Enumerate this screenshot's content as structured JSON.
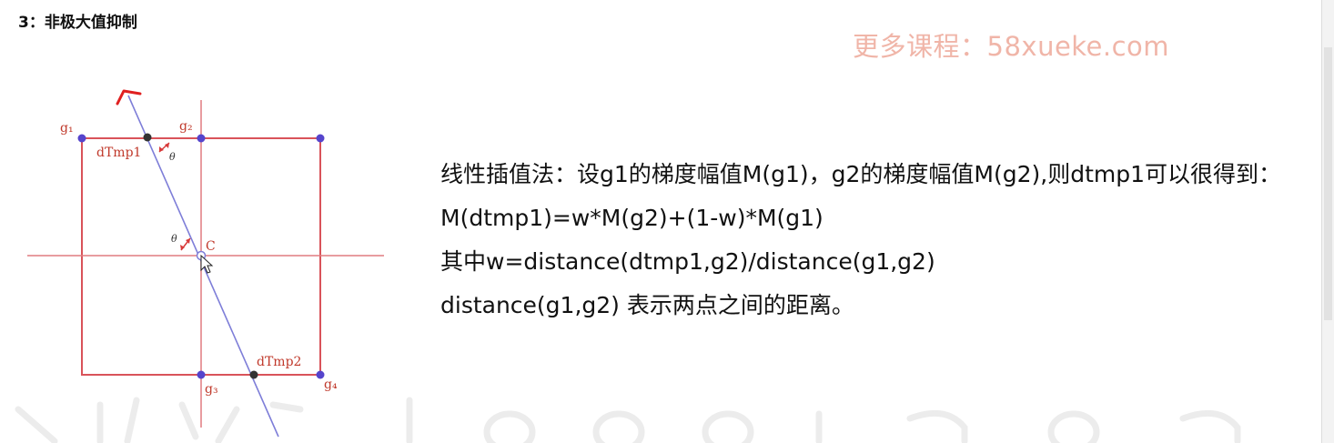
{
  "title": "3：非极大值抑制",
  "watermark": "更多课程：58xueke.com",
  "text_lines": [
    "线性插值法：设g1的梯度幅值M(g1)，g2的梯度幅值M(g2),则dtmp1可以很得到：",
    "M(dtmp1)=w*M(g2)+(1-w)*M(g1)",
    "其中w=distance(dtmp1,g2)/distance(g1,g2)",
    "distance(g1,g2) 表示两点之间的距离。"
  ],
  "diagram": {
    "labels": {
      "g1": "g₁",
      "g2": "g₂",
      "g3": "g₃",
      "g4": "g₄",
      "dtmp1": "dTmp1",
      "dtmp2": "dTmp2",
      "c": "C",
      "theta_top": "θ",
      "theta_center": "θ"
    },
    "colors": {
      "grid": "#d9535a",
      "diagonal": "#7e7ed8",
      "grid_point": "#5544cc",
      "interp_point": "#333333",
      "label": "#c0392b"
    }
  }
}
